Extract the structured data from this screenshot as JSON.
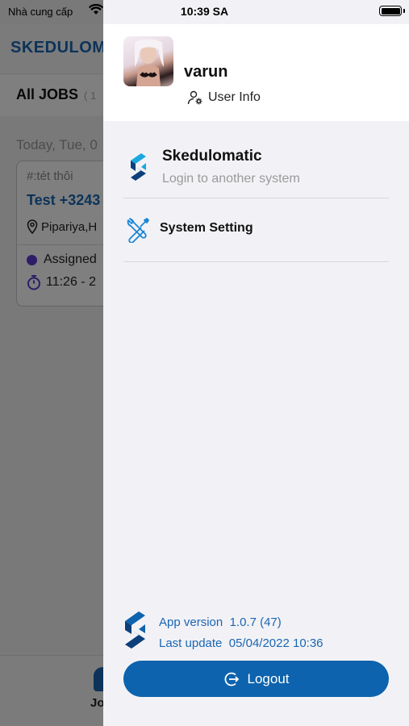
{
  "status_bar": {
    "carrier": "Nhà cung cấp",
    "time": "10:39 SA"
  },
  "background": {
    "app_title": "SKEDULOM",
    "tab_label": "All JOBS",
    "tab_count": "( 1",
    "date": "Today, Tue, 0",
    "card": {
      "tag": "#:tét thôi",
      "title": "Test +3243",
      "location": "Pipariya,H",
      "status": "Assigned",
      "time": "11:26 - 2"
    },
    "bottom_tab": "Jo"
  },
  "drawer": {
    "user_name": "varun",
    "user_info_label": "User Info",
    "menu": [
      {
        "title": "Skedulomatic",
        "subtitle": "Login to another system"
      },
      {
        "title": "System Setting"
      }
    ],
    "app_version_label": "App version",
    "app_version_value": "1.0.7 (47)",
    "last_update_label": "Last update",
    "last_update_value": "05/04/2022 10:36",
    "logout_label": "Logout"
  },
  "colors": {
    "primary": "#0d63ad",
    "accent": "#1aa7e0",
    "status_dot": "#5b3bd1"
  },
  "icons": [
    "wifi-icon",
    "battery-icon",
    "user-gear-icon",
    "skedulomatic-logo-icon",
    "tools-icon",
    "logout-icon",
    "location-pin-icon",
    "stopwatch-icon"
  ]
}
